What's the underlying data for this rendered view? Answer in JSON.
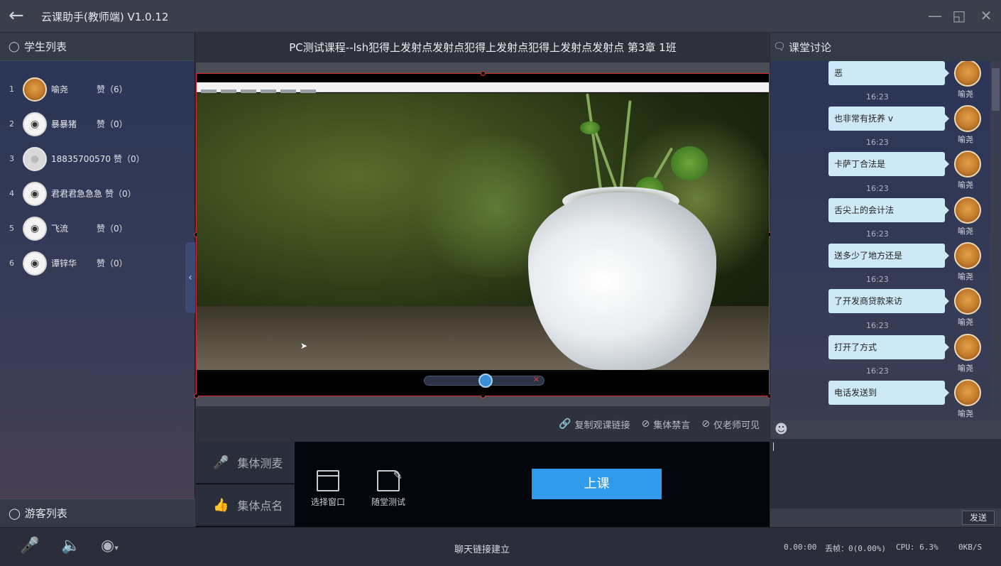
{
  "window": {
    "title": "云课助手(教师端) V1.0.12"
  },
  "students": {
    "header": "学生列表",
    "items": [
      {
        "index": "1",
        "name": "喻尧",
        "likes": "赞（6）",
        "avatar": "dog-avatar"
      },
      {
        "index": "2",
        "name": "暴暴猪",
        "likes": "赞（0）",
        "avatar": "glasses-avatar"
      },
      {
        "index": "3",
        "name": "18835700570",
        "likes": "赞（0）",
        "avatar": "default-avatar"
      },
      {
        "index": "4",
        "name": "君君君急急急",
        "likes": "赞（0）",
        "avatar": "glasses-avatar"
      },
      {
        "index": "5",
        "name": "飞流",
        "likes": "赞（0）",
        "avatar": "glasses-avatar"
      },
      {
        "index": "6",
        "name": "谭锌华",
        "likes": "赞（0）",
        "avatar": "glasses-avatar"
      }
    ]
  },
  "guests": {
    "header": "游客列表"
  },
  "course": {
    "title": "PC测试课程--lsh犯得上发射点发射点犯得上发射点犯得上发射点发射点 第3章 1班"
  },
  "actions": {
    "copy_link": "复制观课链接",
    "mute_all": "集体禁言",
    "teacher_only": "仅老师可见"
  },
  "controls": {
    "mic_test": "集体测麦",
    "roll_call": "集体点名",
    "select_window": "选择窗口",
    "quiz": "随堂测试",
    "start_class": "上课"
  },
  "chat": {
    "header": "课堂讨论",
    "messages": [
      {
        "text": "恶",
        "sender": "喻尧",
        "time": ""
      },
      {
        "text": "也非常有抚养 v",
        "sender": "喻尧",
        "time": "16:23"
      },
      {
        "text": "卡萨丁合法是",
        "sender": "喻尧",
        "time": "16:23"
      },
      {
        "text": "舌尖上的会计法",
        "sender": "喻尧",
        "time": "16:23"
      },
      {
        "text": "送多少了地方还是",
        "sender": "喻尧",
        "time": "16:23"
      },
      {
        "text": "了开发商贷款来访",
        "sender": "喻尧",
        "time": "16:23"
      },
      {
        "text": "打开了方式",
        "sender": "喻尧",
        "time": "16:23"
      },
      {
        "text": "电话发送到",
        "sender": "喻尧",
        "time": "16:23"
      }
    ],
    "send_label": "发送"
  },
  "status": {
    "center_text": "聊天链接建立",
    "duration": "0.00:00",
    "dropped_frames": "丢帧：0(0.00%)",
    "cpu": "CPU: 6.3%",
    "bandwidth": "0KB/S"
  },
  "colors": {
    "accent": "#2f9bea",
    "bubble": "#cde9f6",
    "frame_border": "#d9262b"
  }
}
